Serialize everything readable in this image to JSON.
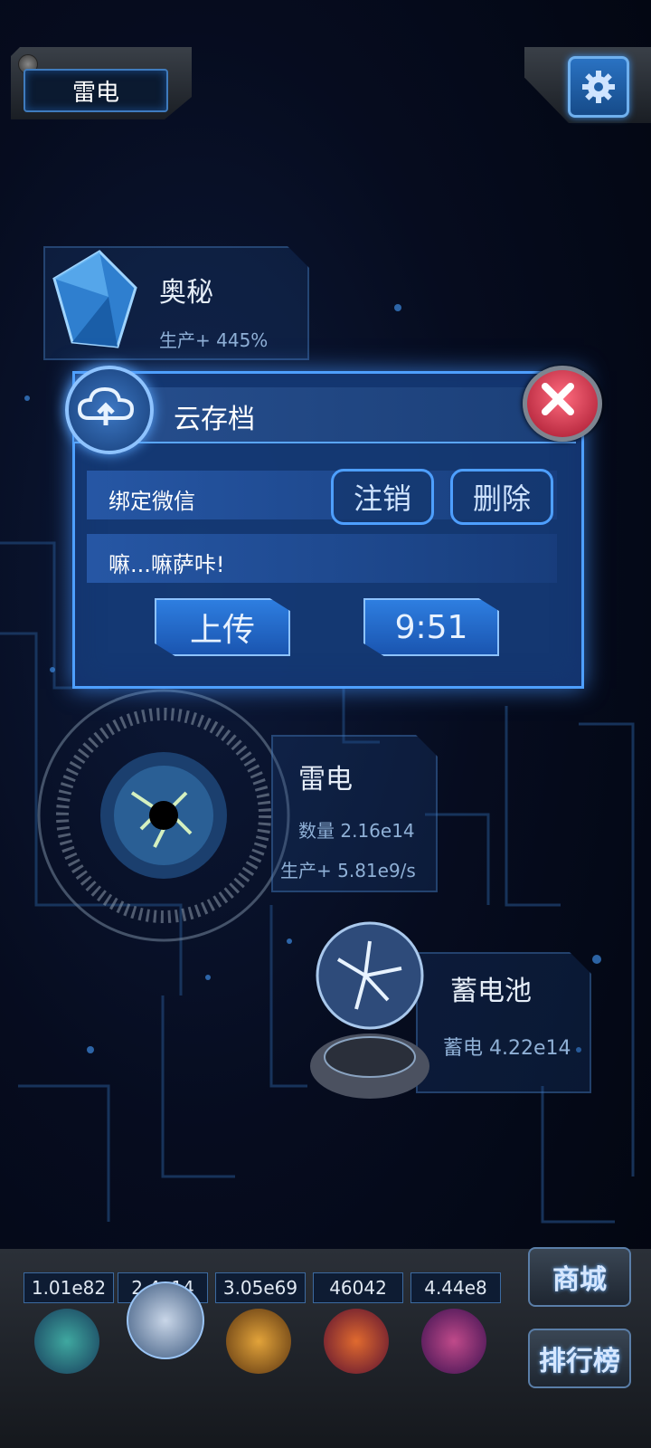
{
  "header": {
    "title": "雷电"
  },
  "panels": {
    "mystery": {
      "title": "奥秘",
      "stat": "生产+ 445%"
    },
    "thunder": {
      "title": "雷电",
      "count": "数量 2.16e14",
      "production": "生产+ 5.81e9/s"
    },
    "battery": {
      "title": "蓄电池",
      "charge": "蓄电 4.22e14"
    }
  },
  "dialog": {
    "title": "云存档",
    "bind_label": "绑定微信",
    "logout_label": "注销",
    "delete_label": "删除",
    "status_text": "嘛...嘛萨咔!",
    "upload_label": "上传",
    "timer": "9:51"
  },
  "resources": [
    {
      "value": "1.01e82"
    },
    {
      "value": "2.4e14"
    },
    {
      "value": "3.05e69"
    },
    {
      "value": "46042"
    },
    {
      "value": "4.44e8"
    }
  ],
  "side_buttons": {
    "shop": "商城",
    "ranking": "排行榜"
  },
  "colors": {
    "accent": "#4e9fff",
    "background": "#060c1f",
    "close": "#c8233c"
  }
}
